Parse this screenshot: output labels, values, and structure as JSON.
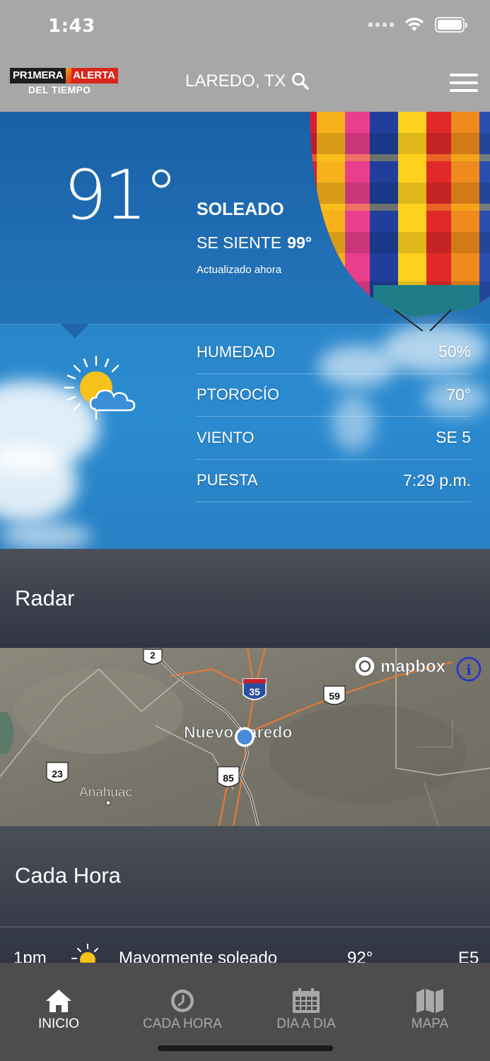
{
  "status_bar": {
    "time": "1:43"
  },
  "header": {
    "logo_line1_left": "PR1MERA",
    "logo_line1_right": "ALERTA",
    "logo_line2": "DEL TIEMPO",
    "location": "LAREDO, TX"
  },
  "current": {
    "temperature": "91°",
    "condition": "SOLEADO",
    "feels_label": "SE SIENTE",
    "feels_value": "99°",
    "updated": "Actualizado ahora"
  },
  "details": [
    {
      "label": "HUMEDAD",
      "value": "50%"
    },
    {
      "label": "PTOROCÍO",
      "value": "70°"
    },
    {
      "label": "VIENTO",
      "value": "SE 5"
    },
    {
      "label": "PUESTA",
      "value": "7:29 p.m."
    }
  ],
  "radar": {
    "title": "Radar",
    "attribution": "mapbox",
    "city_label": "Nuevo Laredo",
    "town_label": "Anáhuac",
    "shields": [
      "2",
      "35",
      "59",
      "23",
      "85"
    ]
  },
  "hourly": {
    "title": "Cada Hora",
    "row": {
      "time": "1pm",
      "condition": "Mayormente soleado",
      "temp": "92°",
      "wind": "E5"
    }
  },
  "tabs": [
    {
      "label": "INICIO",
      "icon": "home-icon",
      "active": true
    },
    {
      "label": "CADA HORA",
      "icon": "clock-icon",
      "active": false
    },
    {
      "label": "DIA A DIA",
      "icon": "calendar-icon",
      "active": false
    },
    {
      "label": "MAPA",
      "icon": "map-icon",
      "active": false
    }
  ]
}
